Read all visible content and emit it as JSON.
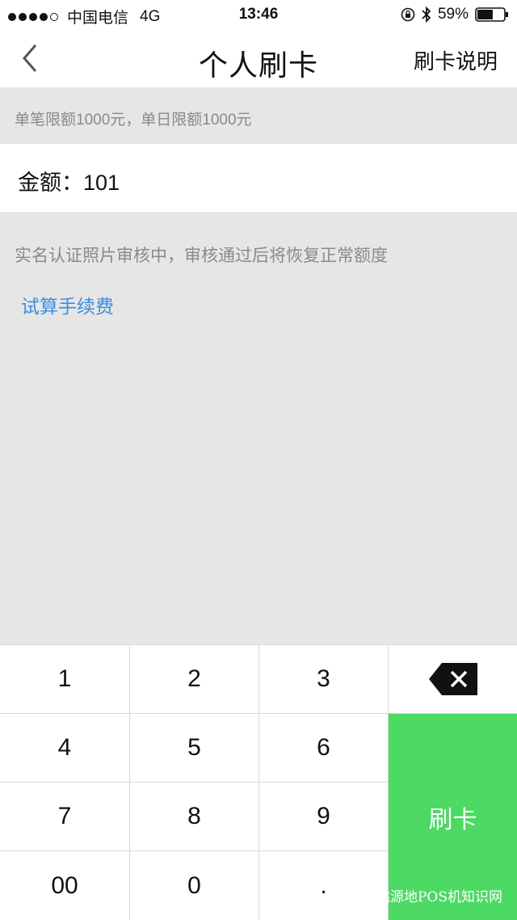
{
  "status_bar": {
    "carrier": "中国电信",
    "network": "4G",
    "time": "13:46",
    "battery": "59%",
    "battery_level": 0.59
  },
  "nav": {
    "title": "个人刷卡",
    "right_link": "刷卡说明"
  },
  "limit_text": "单笔限额1000元，单日限额1000元",
  "amount": {
    "label": "金额：",
    "value": "101"
  },
  "notice": "实名认证照片审核中，审核通过后将恢复正常额度",
  "fee_link": "试算手续费",
  "keypad": {
    "keys": [
      "1",
      "2",
      "3",
      "4",
      "5",
      "6",
      "7",
      "8",
      "9",
      "00",
      "0",
      "."
    ],
    "swipe_label": "刷卡"
  },
  "watermark": "桃源地POS机知识网",
  "colors": {
    "accent_green": "#4cd964",
    "link_blue": "#3a8ee0",
    "background": "#e6e6e6"
  },
  "icons": [
    "back-arrow-icon",
    "rotation-lock-icon",
    "bluetooth-icon",
    "battery-icon",
    "backspace-icon"
  ]
}
